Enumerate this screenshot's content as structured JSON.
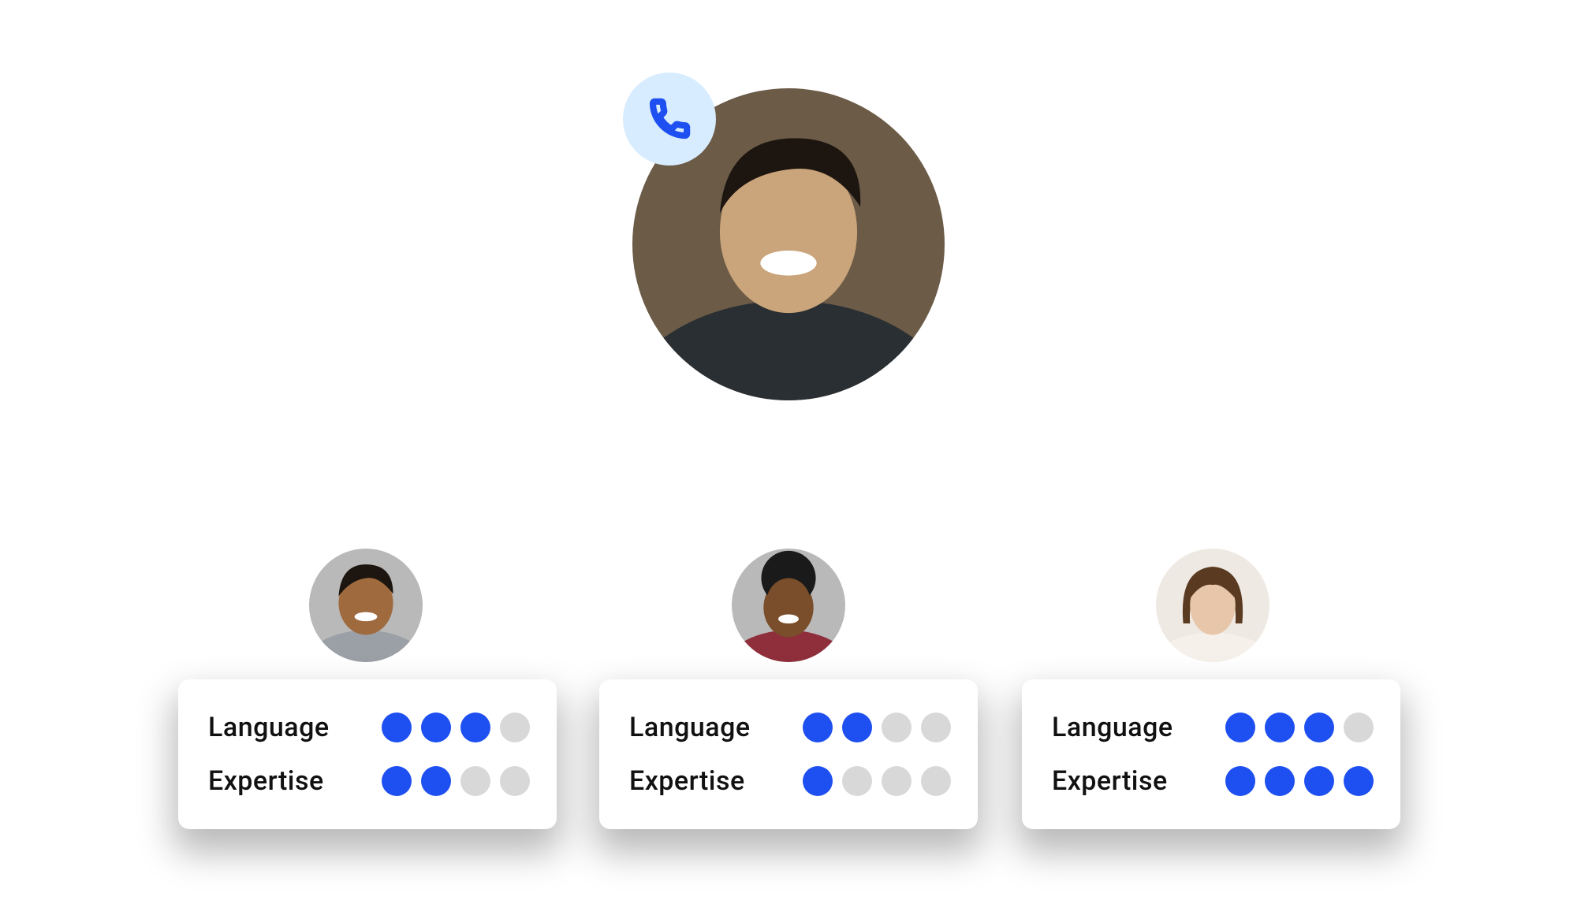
{
  "colors": {
    "accent": "#1e4ff0",
    "badge_bg": "#d8ecff",
    "dot_off": "#d8d8d8",
    "connector": "#ffffff",
    "card_bg": "#ffffff"
  },
  "caller": {
    "badge_icon": "phone-icon"
  },
  "skill_labels": {
    "language": "Language",
    "expertise": "Expertise"
  },
  "agents": [
    {
      "id": "agent-1",
      "skills": {
        "language": 3,
        "expertise": 2
      },
      "max": 4
    },
    {
      "id": "agent-2",
      "skills": {
        "language": 2,
        "expertise": 1
      },
      "max": 4
    },
    {
      "id": "agent-3",
      "skills": {
        "language": 3,
        "expertise": 4
      },
      "max": 4
    }
  ]
}
